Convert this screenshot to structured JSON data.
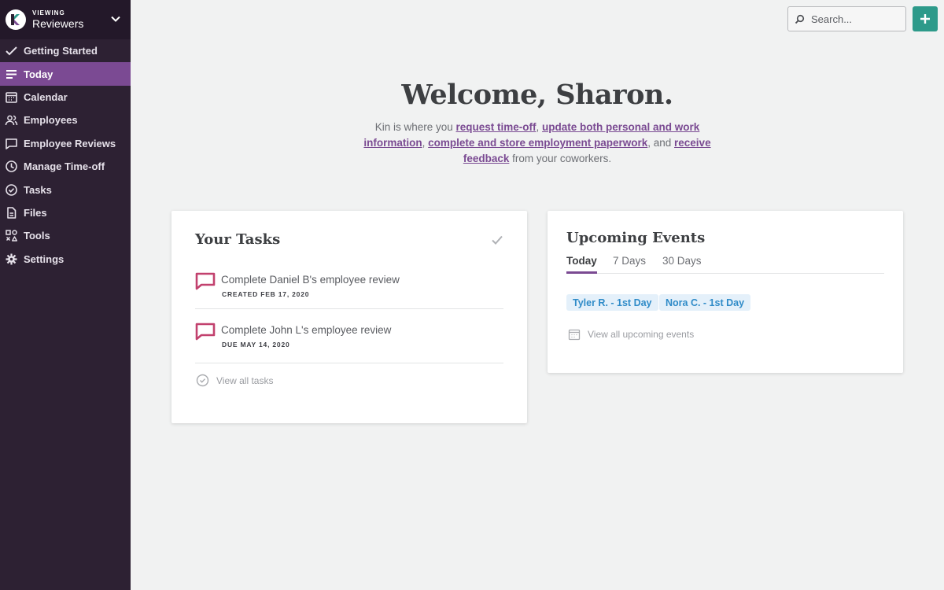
{
  "workspace": {
    "label": "VIEWING",
    "name": "Reviewers"
  },
  "nav": [
    {
      "label": "Getting Started",
      "icon": "check-icon"
    },
    {
      "label": "Today",
      "icon": "lines-icon",
      "active": true
    },
    {
      "label": "Calendar",
      "icon": "calendar-icon"
    },
    {
      "label": "Employees",
      "icon": "people-icon"
    },
    {
      "label": "Employee Reviews",
      "icon": "speech-bubble-icon"
    },
    {
      "label": "Manage Time-off",
      "icon": "clock-icon"
    },
    {
      "label": "Tasks",
      "icon": "check-circle-icon"
    },
    {
      "label": "Files",
      "icon": "file-icon"
    },
    {
      "label": "Tools",
      "icon": "tools-icon"
    },
    {
      "label": "Settings",
      "icon": "gear-icon"
    }
  ],
  "search": {
    "placeholder": "Search..."
  },
  "hero": {
    "title": "Welcome, Sharon.",
    "intro": "Kin is where you",
    "link1": "request time-off",
    "sep1": ", ",
    "link2": "update both personal and work information",
    "sep2": ", ",
    "link3": "complete and store employment paperwork",
    "sep3": ", and ",
    "link4": "receive feedback",
    "outro": " from your coworkers."
  },
  "tasks": {
    "title": "Your Tasks",
    "items": [
      {
        "name": "Complete Daniel B's employee review",
        "meta": "CREATED FEB 17, 2020"
      },
      {
        "name": "Complete John L's employee review",
        "meta": "DUE MAY 14, 2020"
      }
    ],
    "view_all": "View all tasks"
  },
  "events": {
    "title": "Upcoming Events",
    "tabs": [
      "Today",
      "7 Days",
      "30 Days"
    ],
    "chips": [
      "Tyler R. - 1st Day",
      "Nora C. - 1st Day"
    ],
    "view_all": "View all upcoming events"
  },
  "colors": {
    "sidebar": "#2d2133",
    "accent": "#7b4a93",
    "add_button": "#2d9a8a",
    "chip_text": "#2f8bc8",
    "task_icon": "#c2416e"
  }
}
